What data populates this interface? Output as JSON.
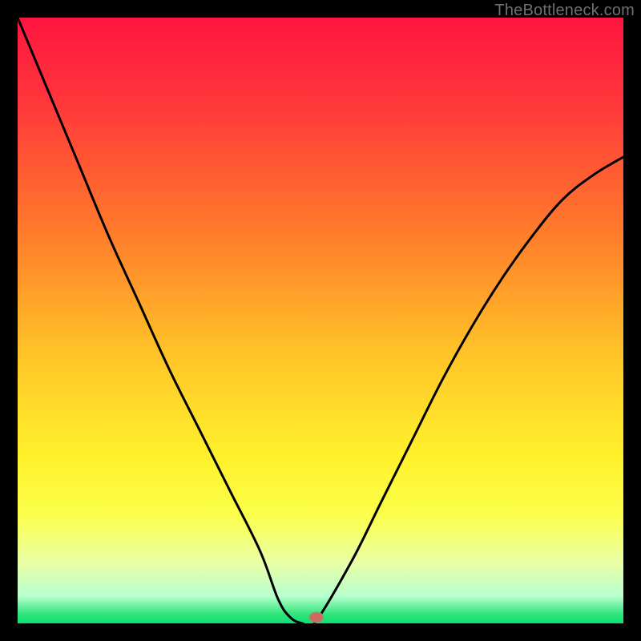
{
  "watermark": "TheBottleneck.com",
  "colors": {
    "frame": "#000000",
    "curve": "#000000",
    "marker_fill": "#cf6a62",
    "marker_stroke": "#72b06d",
    "gradient_stops": [
      {
        "offset": 0.0,
        "color": "#ff1440"
      },
      {
        "offset": 0.15,
        "color": "#ff3a3a"
      },
      {
        "offset": 0.35,
        "color": "#ff7a2b"
      },
      {
        "offset": 0.55,
        "color": "#ffc228"
      },
      {
        "offset": 0.72,
        "color": "#fff02a"
      },
      {
        "offset": 0.82,
        "color": "#fbff4a"
      },
      {
        "offset": 0.9,
        "color": "#eaffa6"
      },
      {
        "offset": 0.955,
        "color": "#b8ffcf"
      },
      {
        "offset": 0.985,
        "color": "#2fe57a"
      },
      {
        "offset": 1.0,
        "color": "#0be074"
      }
    ]
  },
  "chart_data": {
    "type": "line",
    "title": "",
    "xlabel": "",
    "ylabel": "",
    "xlim": [
      0,
      1
    ],
    "ylim": [
      0,
      1
    ],
    "series": [
      {
        "name": "bottleneck-curve",
        "x": [
          0.0,
          0.05,
          0.1,
          0.15,
          0.2,
          0.25,
          0.3,
          0.35,
          0.4,
          0.43,
          0.45,
          0.47,
          0.49,
          0.55,
          0.6,
          0.65,
          0.7,
          0.75,
          0.8,
          0.85,
          0.9,
          0.95,
          1.0
        ],
        "y": [
          1.0,
          0.88,
          0.76,
          0.64,
          0.53,
          0.42,
          0.32,
          0.22,
          0.12,
          0.04,
          0.01,
          0.0,
          0.0,
          0.1,
          0.2,
          0.3,
          0.4,
          0.49,
          0.57,
          0.64,
          0.7,
          0.74,
          0.77
        ]
      }
    ],
    "marker": {
      "x": 0.493,
      "y": 0.002
    },
    "annotations": []
  }
}
